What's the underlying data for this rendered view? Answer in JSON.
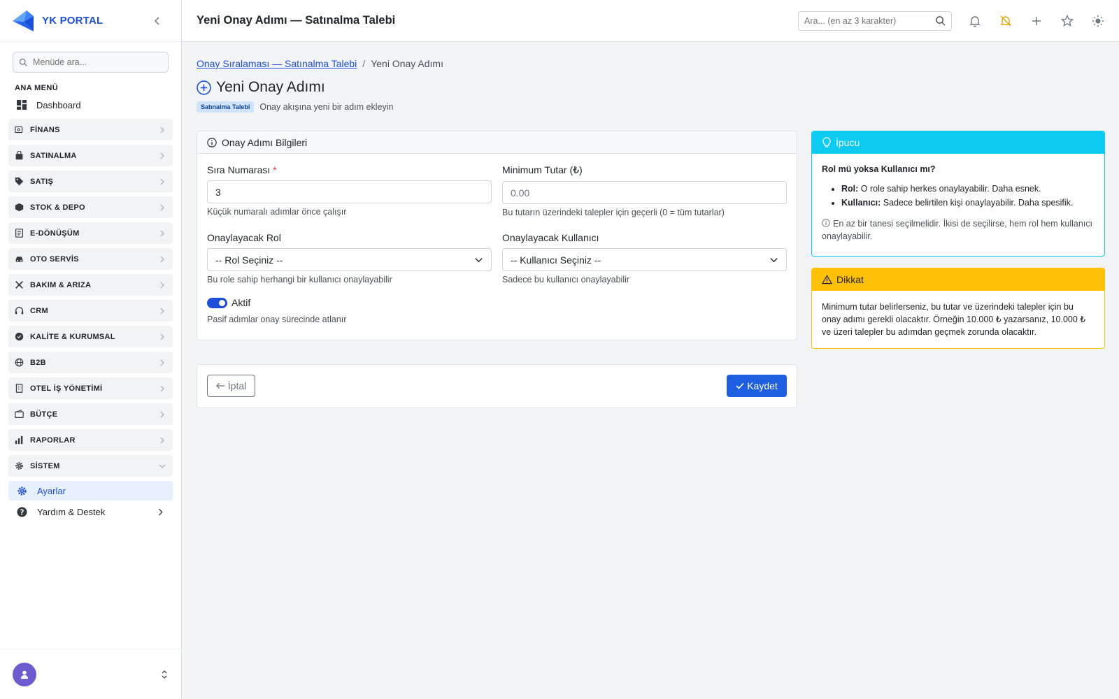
{
  "app": {
    "brand": "YK PORTAL"
  },
  "sidebar": {
    "search_placeholder": "Menüde ara...",
    "section_heading": "ANA MENÜ",
    "dashboard": "Dashboard",
    "groups": [
      {
        "label": "FİNANS",
        "icon": "finance-icon"
      },
      {
        "label": "SATINALMA",
        "icon": "shopping-bag-icon"
      },
      {
        "label": "SATIŞ",
        "icon": "tag-icon"
      },
      {
        "label": "STOK & DEPO",
        "icon": "box-icon"
      },
      {
        "label": "E-DÖNÜŞÜM",
        "icon": "document-icon"
      },
      {
        "label": "OTO SERVİS",
        "icon": "car-icon"
      },
      {
        "label": "BAKIM & ARIZA",
        "icon": "tools-icon"
      },
      {
        "label": "CRM",
        "icon": "headset-icon"
      },
      {
        "label": "KALİTE & KURUMSAL",
        "icon": "award-icon"
      },
      {
        "label": "B2B",
        "icon": "globe-icon"
      },
      {
        "label": "OTEL İŞ YÖNETİMİ",
        "icon": "building-icon"
      },
      {
        "label": "BÜTÇE",
        "icon": "wallet-icon"
      },
      {
        "label": "RAPORLAR",
        "icon": "bar-chart-icon"
      },
      {
        "label": "SİSTEM",
        "icon": "gear-icon",
        "expanded": true
      }
    ],
    "active_sub": "Ayarlar",
    "help": "Yardım & Destek"
  },
  "topbar": {
    "title": "Yeni Onay Adımı — Satınalma Talebi",
    "search_placeholder": "Ara... (en az 3 karakter)"
  },
  "breadcrumb": {
    "parent": "Onay Sıralaması — Satınalma Talebi",
    "separator": "/",
    "current": "Yeni Onay Adımı"
  },
  "page": {
    "title": "Yeni Onay Adımı",
    "badge": "Satınalma Talebi",
    "description": "Onay akışına yeni bir adım ekleyin"
  },
  "form": {
    "header": "Onay Adımı Bilgileri",
    "order": {
      "label": "Sıra Numarası",
      "required_mark": "*",
      "value": "3",
      "hint": "Küçük numaralı adımlar önce çalışır"
    },
    "min_amount": {
      "label": "Minimum Tutar (₺)",
      "placeholder": "0.00",
      "hint": "Bu tutarın üzerindeki talepler için geçerli (0 = tüm tutarlar)"
    },
    "role": {
      "label": "Onaylayacak Rol",
      "selected": "-- Rol Seçiniz --",
      "hint": "Bu role sahip herhangi bir kullanıcı onaylayabilir"
    },
    "user": {
      "label": "Onaylayacak Kullanıcı",
      "selected": "-- Kullanıcı Seçiniz --",
      "hint": "Sadece bu kullanıcı onaylayabilir"
    },
    "active": {
      "label": "Aktif",
      "checked": true,
      "hint": "Pasif adımlar onay sürecinde atlanır"
    }
  },
  "actions": {
    "cancel": "İptal",
    "save": "Kaydet"
  },
  "tip": {
    "header": "İpucu",
    "question": "Rol mü yoksa Kullanıcı mı?",
    "items": [
      {
        "term": "Rol:",
        "text": " O role sahip herkes onaylayabilir. Daha esnek."
      },
      {
        "term": "Kullanıcı:",
        "text": " Sadece belirtilen kişi onaylayabilir. Daha spesifik."
      }
    ],
    "note": "En az bir tanesi seçilmelidir. İkisi de seçilirse, hem rol hem kullanıcı onaylayabilir."
  },
  "warning": {
    "header": "Dikkat",
    "text": "Minimum tutar belirlerseniz, bu tutar ve üzerindeki talepler için bu onay adımı gerekli olacaktır. Örneğin 10.000 ₺ yazarsanız, 10.000 ₺ ve üzeri talepler bu adımdan geçmek zorunda olacaktır."
  },
  "colors": {
    "primary": "#1d4ed8",
    "info": "#0dcaf0",
    "warning": "#ffc107",
    "danger": "#dc3545"
  }
}
